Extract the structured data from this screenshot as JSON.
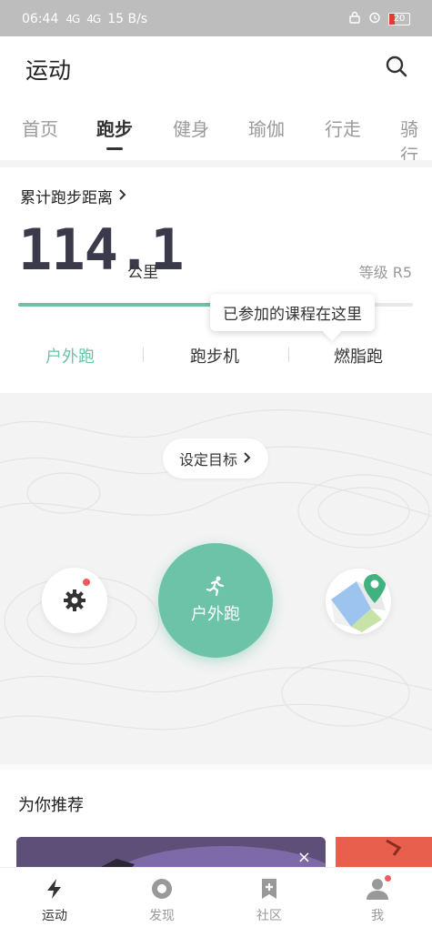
{
  "status_bar": {
    "time": "06:44",
    "signal1": "4G",
    "signal2": "4G",
    "speed": "15 B/s",
    "battery": "20"
  },
  "app_bar": {
    "title": "运动"
  },
  "tabs": [
    {
      "label": "首页"
    },
    {
      "label": "跑步"
    },
    {
      "label": "健身"
    },
    {
      "label": "瑜伽"
    },
    {
      "label": "行走"
    },
    {
      "label": "骑行"
    }
  ],
  "summary": {
    "label": "累计跑步距离",
    "distance": "114.1",
    "unit": "公里",
    "level": "等级 R5",
    "progress_fraction": 0.53
  },
  "tooltip": {
    "text": "已参加的课程在这里"
  },
  "modes": [
    {
      "label": "户外跑"
    },
    {
      "label": "跑步机"
    },
    {
      "label": "燃脂跑"
    }
  ],
  "run_panel": {
    "goal_label": "设定目标",
    "start_label": "户外跑"
  },
  "recommend": {
    "title": "为你推荐",
    "close_symbol": "×"
  },
  "bottom_nav": [
    {
      "label": "运动"
    },
    {
      "label": "发现"
    },
    {
      "label": "社区"
    },
    {
      "label": "我"
    }
  ],
  "colors": {
    "accent": "#6cc3a8",
    "status_bar": "#bdbdbd",
    "badge": "#f25b5b"
  }
}
